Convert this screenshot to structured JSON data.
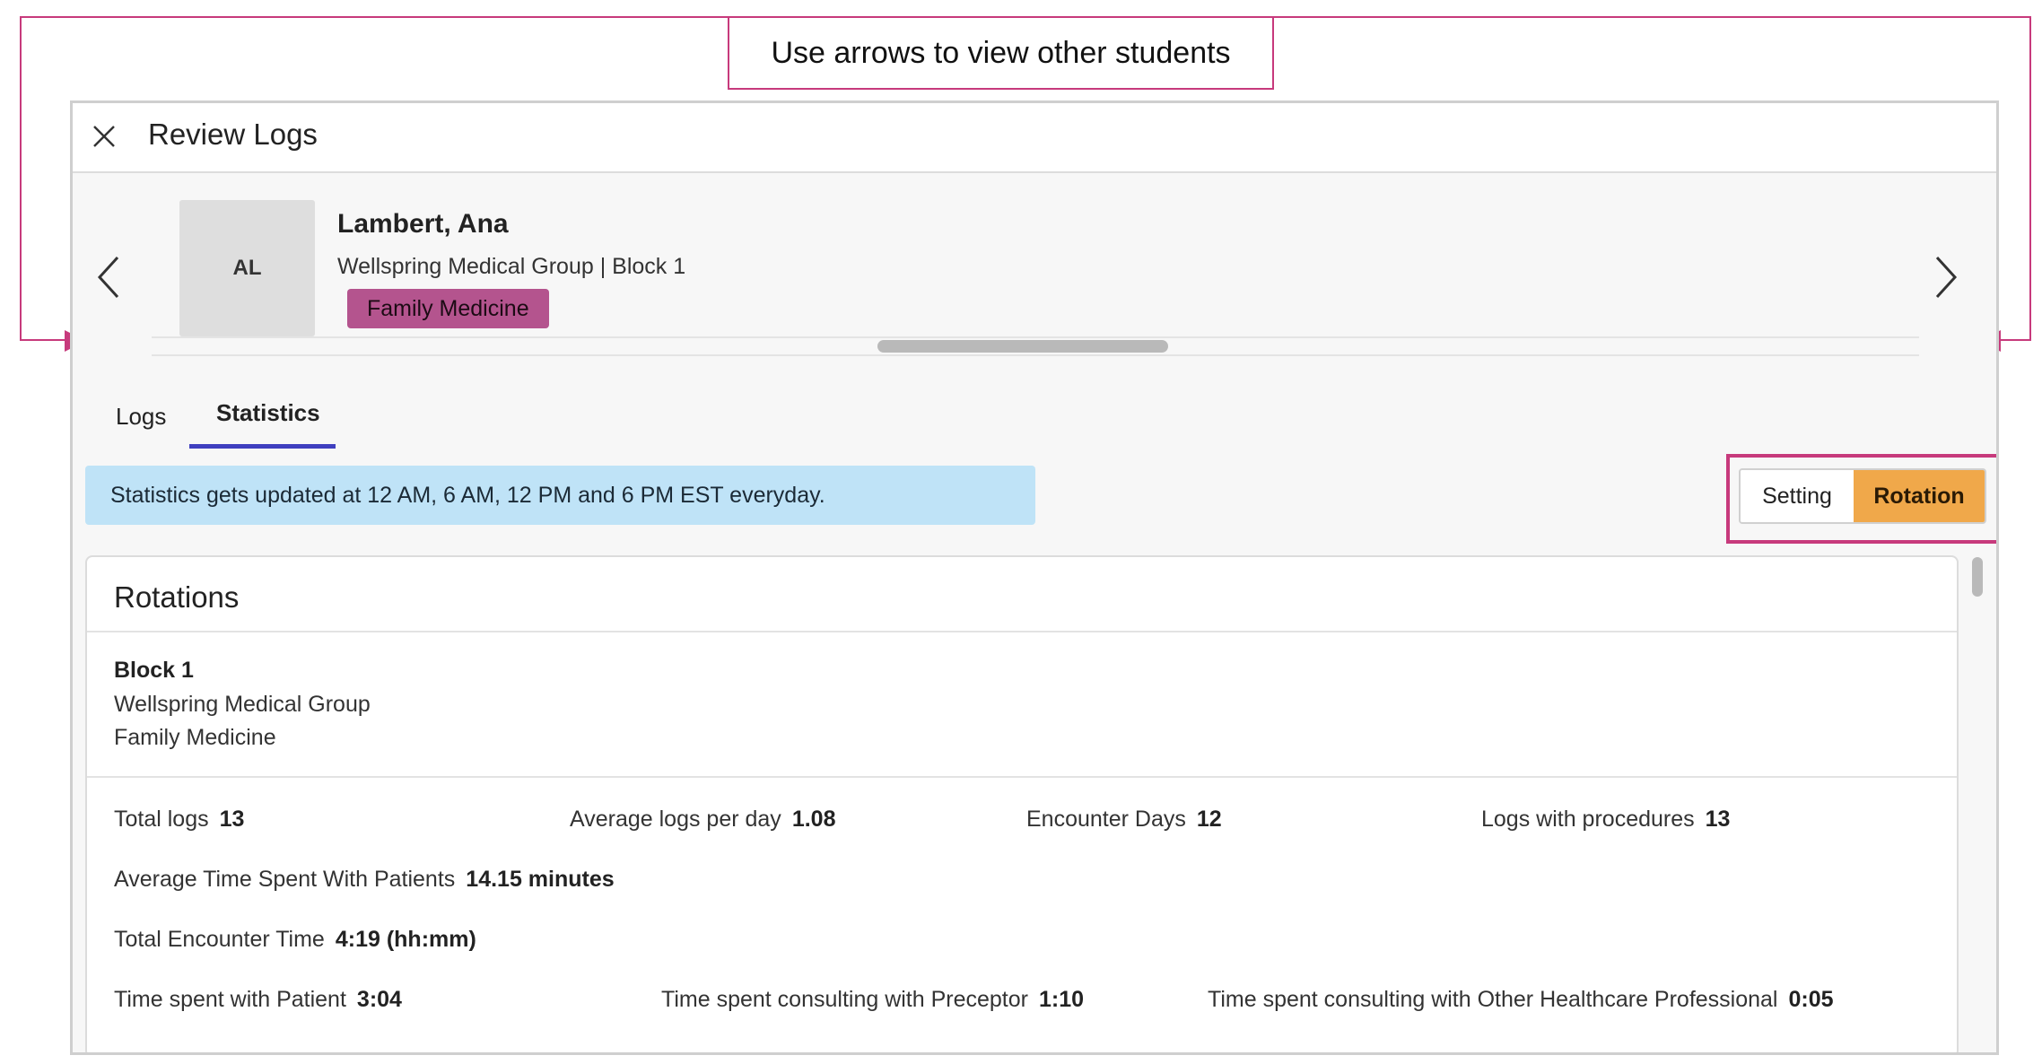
{
  "callout": {
    "text": "Use arrows to view other students",
    "color": "#c73a7c"
  },
  "modal": {
    "title": "Review Logs",
    "close_icon": "close-icon"
  },
  "student": {
    "initials": "AL",
    "name": "Lambert, Ana",
    "meta": "Wellspring Medical Group | Block 1",
    "specialty": "Family Medicine",
    "badge_color": "#b4548e"
  },
  "nav": {
    "prev_icon": "chevron-left-icon",
    "next_icon": "chevron-right-icon"
  },
  "tabs": [
    {
      "label": "Logs",
      "active": false
    },
    {
      "label": "Statistics",
      "active": true
    }
  ],
  "info_banner": "Statistics gets updated at 12 AM, 6 AM, 12 PM and 6 PM EST everyday.",
  "toggle": {
    "options": [
      "Setting",
      "Rotation"
    ],
    "selected": "Rotation",
    "accent": "#f0a84a"
  },
  "rotations": {
    "title": "Rotations",
    "block": {
      "title": "Block 1",
      "site": "Wellspring Medical Group",
      "specialty": "Family Medicine"
    },
    "stats": {
      "total_logs": {
        "label": "Total logs",
        "value": "13"
      },
      "avg_logs_per_day": {
        "label": "Average logs per day",
        "value": "1.08"
      },
      "encounter_days": {
        "label": "Encounter Days",
        "value": "12"
      },
      "logs_with_procedures": {
        "label": "Logs with procedures",
        "value": "13"
      },
      "avg_time_with_patients": {
        "label": "Average Time Spent With Patients",
        "value": "14.15 minutes"
      },
      "total_encounter_time": {
        "label": "Total Encounter Time",
        "value": "4:19 (hh:mm)"
      },
      "time_with_patient": {
        "label": "Time spent with Patient",
        "value": "3:04"
      },
      "time_consulting_preceptor": {
        "label": "Time spent consulting with Preceptor",
        "value": "1:10"
      },
      "time_consulting_other": {
        "label": "Time spent consulting with Other Healthcare Professional",
        "value": "0:05"
      }
    }
  }
}
